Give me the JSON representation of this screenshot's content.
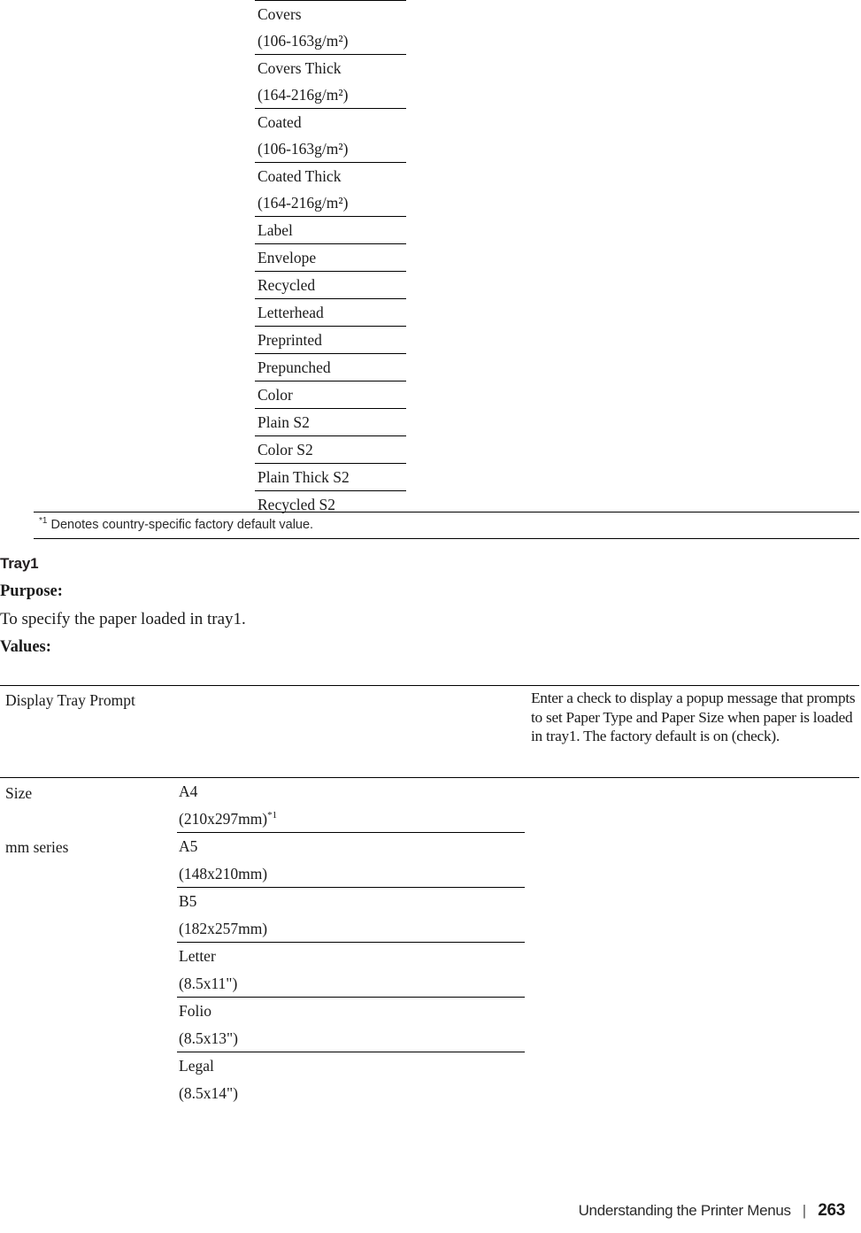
{
  "paper_type_table": {
    "rows": [
      {
        "lines": [
          "Covers",
          "(106-163g/m²)"
        ]
      },
      {
        "lines": [
          "Covers Thick",
          "(164-216g/m²)"
        ]
      },
      {
        "lines": [
          "Coated",
          "(106-163g/m²)"
        ]
      },
      {
        "lines": [
          "Coated Thick",
          "(164-216g/m²)"
        ]
      },
      {
        "lines": [
          "Label"
        ]
      },
      {
        "lines": [
          "Envelope"
        ]
      },
      {
        "lines": [
          "Recycled"
        ]
      },
      {
        "lines": [
          "Letterhead"
        ]
      },
      {
        "lines": [
          "Preprinted"
        ]
      },
      {
        "lines": [
          "Prepunched"
        ]
      },
      {
        "lines": [
          "Color"
        ]
      },
      {
        "lines": [
          "Plain S2"
        ]
      },
      {
        "lines": [
          "Color S2"
        ]
      },
      {
        "lines": [
          "Plain Thick S2"
        ]
      },
      {
        "lines": [
          "Recycled S2"
        ]
      }
    ]
  },
  "footnote": {
    "marker": "*1",
    "text": " Denotes country-specific factory default value."
  },
  "section": {
    "heading": "Tray1",
    "purpose_label": "Purpose:",
    "purpose_text": "To specify the paper loaded in tray1.",
    "values_label": "Values:"
  },
  "values_table": {
    "display_tray_prompt": {
      "label": "Display Tray Prompt",
      "description": "Enter a check to display a popup message that prompts to set Paper Type and Paper Size when paper is loaded in tray1. The factory default is on (check)."
    },
    "size": {
      "label": "Size",
      "sublabel": "mm series",
      "items": [
        {
          "name": "A4",
          "dimensions": "(210x297mm)",
          "footnote": "*1"
        },
        {
          "name": "A5",
          "dimensions": "(148x210mm)",
          "footnote": ""
        },
        {
          "name": "B5",
          "dimensions": "(182x257mm)",
          "footnote": ""
        },
        {
          "name": "Letter",
          "dimensions": "(8.5x11\")",
          "footnote": ""
        },
        {
          "name": "Folio",
          "dimensions": "(8.5x13\")",
          "footnote": ""
        },
        {
          "name": "Legal",
          "dimensions": "(8.5x14\")",
          "footnote": ""
        }
      ]
    }
  },
  "footer": {
    "title": "Understanding the Printer Menus",
    "separator": "|",
    "page_number": "263"
  }
}
